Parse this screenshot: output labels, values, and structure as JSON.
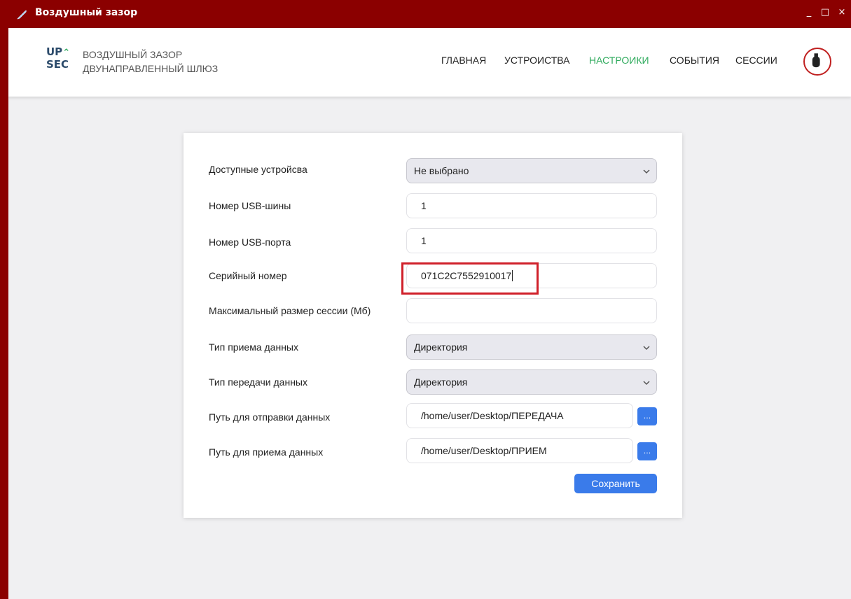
{
  "window": {
    "title": "Воздушный зазор",
    "controls": {
      "minimize": "_",
      "maximize": "□",
      "close": "×"
    }
  },
  "header": {
    "logo_line1": "UP",
    "logo_line2": "SEC",
    "subtitle_line1": "Воздушный зазор",
    "subtitle_line2": "Двунаправленный шлюз",
    "nav": [
      {
        "label": "Главная"
      },
      {
        "label": "Устроиства"
      },
      {
        "label": "Настроики"
      },
      {
        "label": "События"
      },
      {
        "label": "Сессии"
      }
    ],
    "active_nav": "Настроики",
    "usb_icon": "usb-drive-icon"
  },
  "form": {
    "devices": {
      "label": "Доступные устройсва",
      "value": "Не выбрано"
    },
    "usb_bus": {
      "label": "Номер USB-шины",
      "value": "1"
    },
    "usb_port": {
      "label": "Номер USB-порта",
      "value": "1"
    },
    "serial": {
      "label": "Серийный номер",
      "value": "071C2C7552910017"
    },
    "max_session": {
      "label": "Максимальный размер сессии (Мб)",
      "value": ""
    },
    "receive_type": {
      "label": "Тип приема данных",
      "value": "Директория"
    },
    "send_type": {
      "label": "Тип передачи данных",
      "value": "Директория"
    },
    "send_path": {
      "label": "Путь для отправки данных",
      "value": "/home/user/Desktop/ПЕРЕДАЧА",
      "browse": "..."
    },
    "receive_path": {
      "label": "Путь для приема данных",
      "value": "/home/user/Desktop/ПРИЕМ",
      "browse": "..."
    },
    "save_label": "Сохранить"
  },
  "colors": {
    "titlebar": "#8b0000",
    "accent_green": "#2eaa5c",
    "button_blue": "#3a7bea",
    "highlight_red": "#d0202a"
  }
}
